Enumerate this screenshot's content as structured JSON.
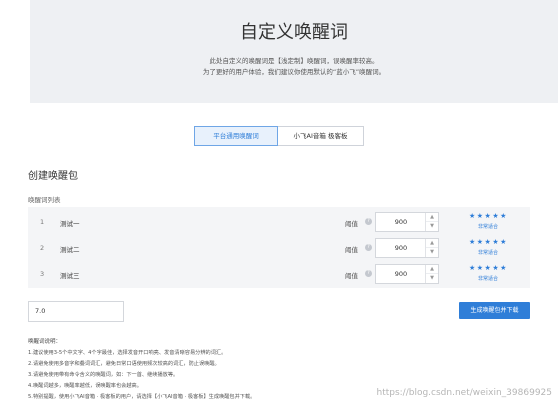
{
  "hero": {
    "title": "自定义唤醒词",
    "desc_line1": "此处自定义的唤醒词是【浅定制】唤醒词，误唤醒率较高。",
    "desc_line2": "为了更好的用户体验，我们建议你使用默认的“蓝小飞”唤醒词。"
  },
  "tabs": [
    {
      "label": "平台通用唤醒词",
      "active": true
    },
    {
      "label": "小飞AI音箱 极客板",
      "active": false
    }
  ],
  "section_title": "创建唤醒包",
  "list_label": "唤醒词列表",
  "rows": [
    {
      "index": "1",
      "name": "测试一",
      "threshold_label": "阈值",
      "help_icon": "question-icon",
      "value": "900",
      "stars": "★★★★★",
      "rating_text": "非常适合"
    },
    {
      "index": "2",
      "name": "测试二",
      "threshold_label": "阈值",
      "help_icon": "question-icon",
      "value": "900",
      "stars": "★★★★★",
      "rating_text": "非常适合"
    },
    {
      "index": "3",
      "name": "测试三",
      "threshold_label": "阈值",
      "help_icon": "question-icon",
      "value": "900",
      "stars": "★★★★★",
      "rating_text": "非常适合"
    }
  ],
  "stepper": {
    "up": "▲",
    "down": "▼"
  },
  "version_input": "7.0",
  "generate_button": "生成唤醒包并下载",
  "notes": {
    "title": "唤醒词说明：",
    "items": [
      "1.建议使用3-5个中文字、4个字最佳，选择发音开口响亮、发音清晰容易分辨的词汇。",
      "2.请避免使用多音字和叠词词汇，避免日常口语使用频次较高的词汇，防止误唤醒。",
      "3.请避免使用带有命令含义的唤醒词，如：下一首、继续播放等。",
      "4.唤醒词越多，唤醒率越低，误唤醒率也会越高。",
      "5.特别提醒，使用小飞AI音箱 · 极客板的用户，请选择【小飞AI音箱 · 极客板】生成唤醒包并下载。"
    ]
  },
  "watermark": "https://blog.csdn.net/weixin_39869925",
  "colors": {
    "accent": "#2f7ed8",
    "hero_bg": "#eef0f3",
    "list_bg": "#f4f5f7"
  }
}
